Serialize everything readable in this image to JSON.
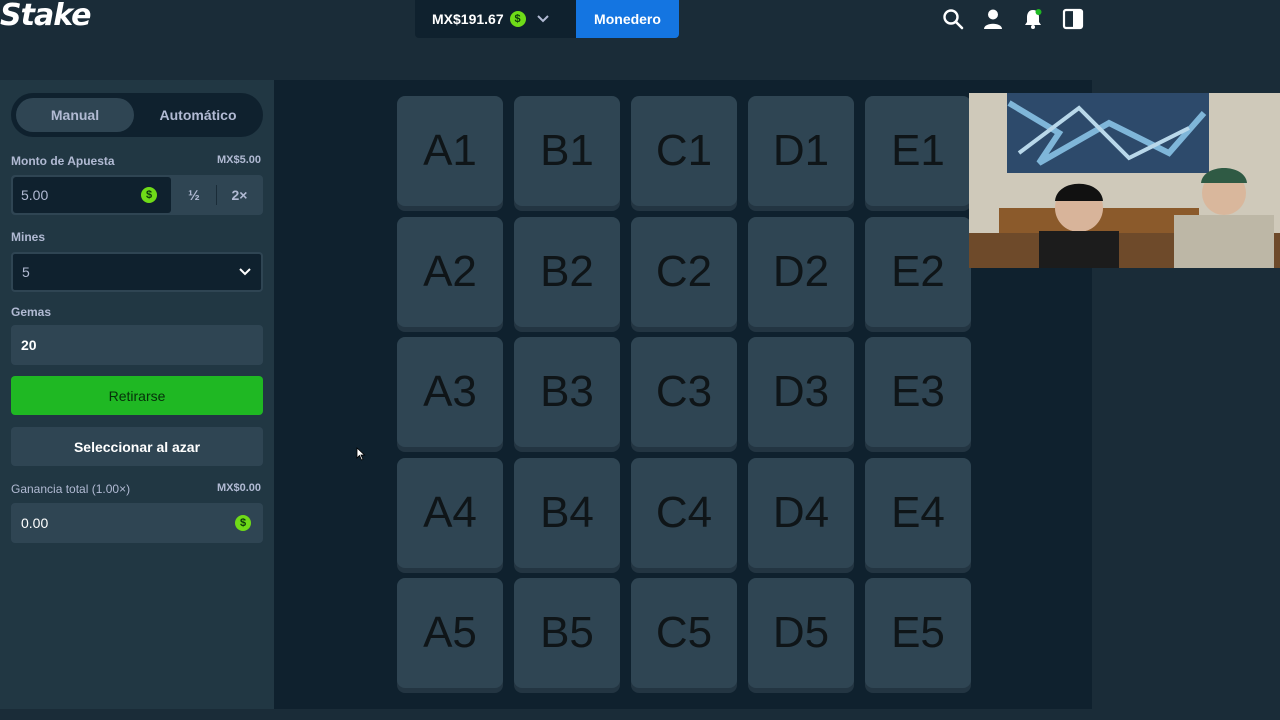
{
  "header": {
    "logo": "Stake",
    "balance": "MX$191.67",
    "coin_symbol": "$",
    "wallet_button": "Monedero"
  },
  "sidebar": {
    "tabs": [
      {
        "label": "Manual",
        "active": true
      },
      {
        "label": "Automático",
        "active": false
      }
    ],
    "bet_amount": {
      "label": "Monto de Apuesta",
      "currency_value": "MX$5.00",
      "value": "5.00",
      "half_label": "½",
      "double_label": "2×"
    },
    "mines": {
      "label": "Mines",
      "value": "5"
    },
    "gems": {
      "label": "Gemas",
      "value": "20"
    },
    "cashout_button": "Retirarse",
    "random_button": "Seleccionar al azar",
    "profit": {
      "label": "Ganancia total (1.00×)",
      "currency_value": "MX$0.00",
      "value": "0.00"
    }
  },
  "grid": {
    "tiles": [
      "A1",
      "B1",
      "C1",
      "D1",
      "E1",
      "A2",
      "B2",
      "C2",
      "D2",
      "E2",
      "A3",
      "B3",
      "C3",
      "D3",
      "E3",
      "A4",
      "B4",
      "C4",
      "D4",
      "E4",
      "A5",
      "B5",
      "C5",
      "D5",
      "E5"
    ]
  },
  "colors": {
    "accent_blue": "#1475e1",
    "cashout_green": "#1fb823",
    "coin_green": "#6fdb18",
    "tile": "#2f4553",
    "panel": "#213743",
    "dark": "#0f212e"
  }
}
